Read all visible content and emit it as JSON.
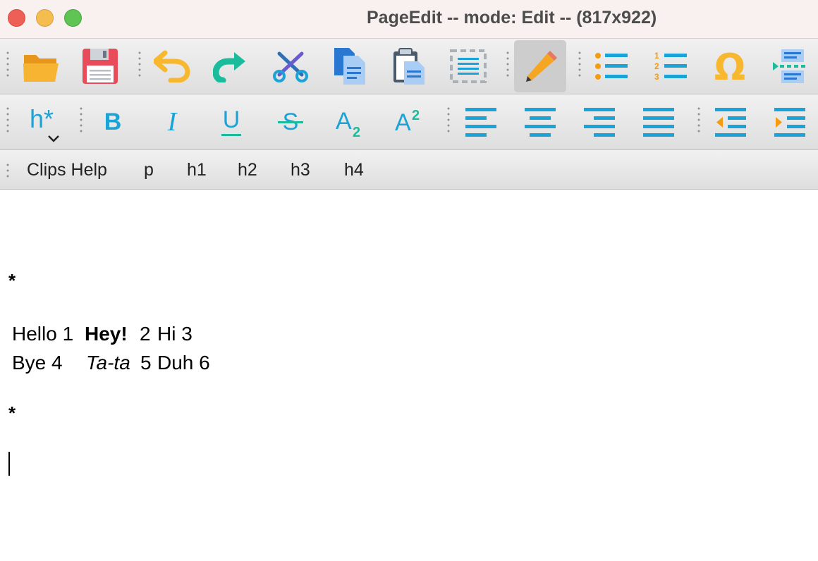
{
  "window": {
    "title": "PageEdit -- mode: Edit -- (817x922)"
  },
  "toolbar_main": {
    "buttons": [
      {
        "name": "open",
        "icon": "folder-open-icon"
      },
      {
        "name": "save",
        "icon": "floppy-disk-icon"
      },
      {
        "name": "undo",
        "icon": "undo-icon"
      },
      {
        "name": "redo",
        "icon": "redo-icon"
      },
      {
        "name": "cut",
        "icon": "scissors-icon"
      },
      {
        "name": "copy",
        "icon": "copy-icon"
      },
      {
        "name": "paste",
        "icon": "paste-icon"
      },
      {
        "name": "select-all",
        "icon": "select-all-icon"
      },
      {
        "name": "edit-mode",
        "icon": "pencil-icon",
        "active": true
      },
      {
        "name": "bulleted-list",
        "icon": "bullet-list-icon"
      },
      {
        "name": "numbered-list",
        "icon": "numbered-list-icon"
      },
      {
        "name": "special-character",
        "icon": "omega-icon"
      },
      {
        "name": "insert-special",
        "icon": "insert-row-icon"
      }
    ]
  },
  "toolbar_format": {
    "heading_label": "h*",
    "bold_label": "B",
    "italic_label": "I",
    "underline_label": "U",
    "strike_label": "S",
    "subscript_label": "A",
    "subscript_sub": "2",
    "superscript_label": "A",
    "superscript_sup": "2"
  },
  "clips_bar": {
    "items": [
      "Clips Help",
      "p",
      "h1",
      "h2",
      "h3",
      "h4"
    ]
  },
  "document": {
    "separator_top": "*",
    "row1": [
      "Hello 1",
      "Hey!",
      "2",
      "Hi 3"
    ],
    "row2": [
      "Bye 4",
      "Ta-ta",
      "5",
      "Duh 6"
    ],
    "separator_bottom": "*"
  },
  "colors": {
    "accent_blue": "#1ba2d6",
    "accent_teal": "#1abc9c",
    "accent_orange": "#f39c12",
    "save_red": "#e84c5a",
    "pencil_orange": "#f5a623"
  }
}
